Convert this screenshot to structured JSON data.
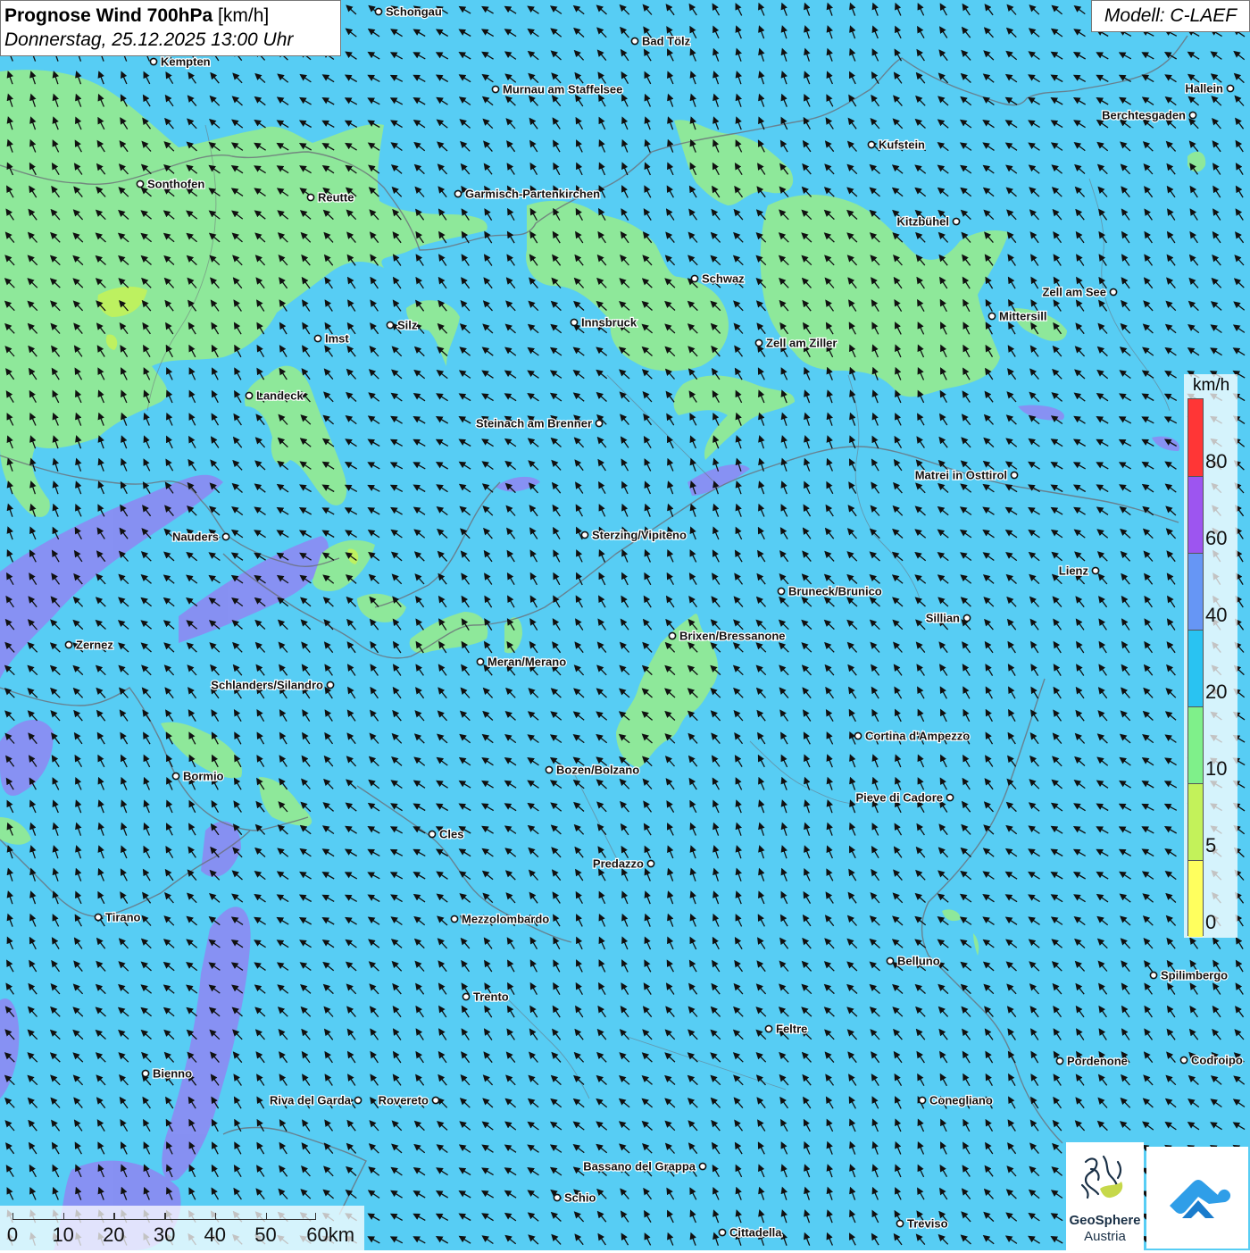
{
  "header": {
    "title": "Prognose Wind 700hPa",
    "unit": "[km/h]",
    "datetime": "Donnerstag, 25.12.2025 13:00 Uhr",
    "model": "Modell: C-LAEF"
  },
  "legend": {
    "unit": "km/h",
    "classes": [
      {
        "label": "80",
        "color": "#ff3636"
      },
      {
        "label": "60",
        "color": "#9d55f0"
      },
      {
        "label": "40",
        "color": "#6696f5"
      },
      {
        "label": "20",
        "color": "#29c3f2"
      },
      {
        "label": "10",
        "color": "#7ff08a"
      },
      {
        "label": "5",
        "color": "#c3f25a"
      },
      {
        "label": "0",
        "color": "#ffff5e"
      }
    ]
  },
  "scale_bar": {
    "labels": [
      "0",
      "10",
      "20",
      "30",
      "40",
      "50",
      "60km"
    ]
  },
  "wind": {
    "dominant_direction": "northwest (arrows pointing NW)",
    "dominant_speed_class": "20-40 km/h"
  },
  "colors": {
    "ocean_blue": "#57cdf4",
    "calm_green": "#8ee89a",
    "strong_purple": "#8f86f2",
    "border_gray": "#6b6f78"
  },
  "places": [
    "Schongau",
    "Bad Tölz",
    "Kempten",
    "Murnau am Staffelsee",
    "Hallein",
    "Berchtesgaden",
    "Kufstein",
    "Sonthofen",
    "Reutte",
    "Garmisch-Partenkirchen",
    "Kitzbühel",
    "Schwaz",
    "Zell am See",
    "Mittersill",
    "Silz",
    "Innsbruck",
    "Imst",
    "Zell am Ziller",
    "Landeck",
    "Steinach am Brenner",
    "Matrei in Osttirol",
    "Nauders",
    "Sterzing/Vipiteno",
    "Lienz",
    "Bruneck/Brunico",
    "Sillian",
    "Zernez",
    "Brixen/Bressanone",
    "Meran/Merano",
    "Schlanders/Silandro",
    "Cortina d'Ampezzo",
    "Bormio",
    "Bozen/Bolzano",
    "Pieve di Cadore",
    "Cles",
    "Predazzo",
    "Tirano",
    "Mezzolombardo",
    "Belluno",
    "Spilimbergo",
    "Trento",
    "Feltre",
    "Pordenone",
    "Codroipo",
    "Bienno",
    "Riva del Garda",
    "Rovereto",
    "Conegliano",
    "Bassano del Grappa",
    "Schio",
    "Treviso",
    "Cittadella"
  ],
  "logos": {
    "geosphere_name": "GeoSphere",
    "geosphere_sub": "Austria"
  }
}
